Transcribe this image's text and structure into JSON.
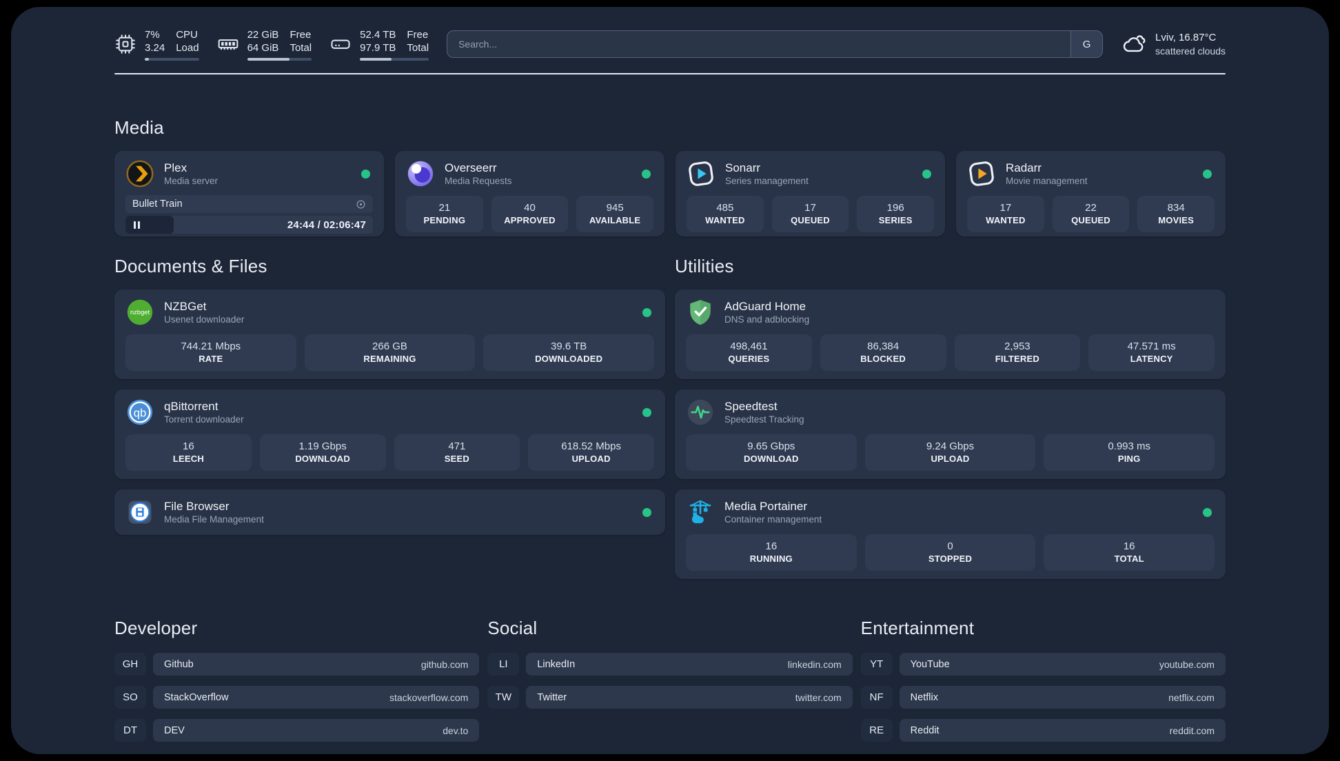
{
  "header": {
    "resources": [
      {
        "values": [
          "7%",
          "3.24"
        ],
        "labels": [
          "CPU",
          "Load"
        ],
        "progress": "7%"
      },
      {
        "values": [
          "22 GiB",
          "64 GiB"
        ],
        "labels": [
          "Free",
          "Total"
        ],
        "progress": "66%"
      },
      {
        "values": [
          "52.4 TB",
          "97.9 TB"
        ],
        "labels": [
          "Free",
          "Total"
        ],
        "progress": "46%"
      }
    ],
    "search": {
      "placeholder": "Search...",
      "provider": "G"
    },
    "weather": {
      "location": "Lviv, 16.87°C",
      "condition": "scattered clouds"
    }
  },
  "media": {
    "title": "Media",
    "plex": {
      "name": "Plex",
      "desc": "Media server",
      "now_playing": {
        "title": "Bullet Train",
        "time_display": "24:44 / 02:06:47",
        "progress": "19.5%"
      }
    },
    "overseerr": {
      "name": "Overseerr",
      "desc": "Media Requests",
      "stats": [
        {
          "value": "21",
          "label": "PENDING"
        },
        {
          "value": "40",
          "label": "APPROVED"
        },
        {
          "value": "945",
          "label": "AVAILABLE"
        }
      ]
    },
    "sonarr": {
      "name": "Sonarr",
      "desc": "Series management",
      "stats": [
        {
          "value": "485",
          "label": "WANTED"
        },
        {
          "value": "17",
          "label": "QUEUED"
        },
        {
          "value": "196",
          "label": "SERIES"
        }
      ]
    },
    "radarr": {
      "name": "Radarr",
      "desc": "Movie management",
      "stats": [
        {
          "value": "17",
          "label": "WANTED"
        },
        {
          "value": "22",
          "label": "QUEUED"
        },
        {
          "value": "834",
          "label": "MOVIES"
        }
      ]
    }
  },
  "documents": {
    "title": "Documents & Files",
    "nzbget": {
      "name": "NZBGet",
      "desc": "Usenet downloader",
      "stats": [
        {
          "value": "744.21 Mbps",
          "label": "RATE"
        },
        {
          "value": "266 GB",
          "label": "REMAINING"
        },
        {
          "value": "39.6 TB",
          "label": "DOWNLOADED"
        }
      ]
    },
    "qbittorrent": {
      "name": "qBittorrent",
      "desc": "Torrent downloader",
      "stats": [
        {
          "value": "16",
          "label": "LEECH"
        },
        {
          "value": "1.19 Gbps",
          "label": "DOWNLOAD"
        },
        {
          "value": "471",
          "label": "SEED"
        },
        {
          "value": "618.52 Mbps",
          "label": "UPLOAD"
        }
      ]
    },
    "filebrowser": {
      "name": "File Browser",
      "desc": "Media File Management"
    }
  },
  "utilities": {
    "title": "Utilities",
    "adguard": {
      "name": "AdGuard Home",
      "desc": "DNS and adblocking",
      "stats": [
        {
          "value": "498,461",
          "label": "QUERIES"
        },
        {
          "value": "86,384",
          "label": "BLOCKED"
        },
        {
          "value": "2,953",
          "label": "FILTERED"
        },
        {
          "value": "47.571 ms",
          "label": "LATENCY"
        }
      ]
    },
    "speedtest": {
      "name": "Speedtest",
      "desc": "Speedtest Tracking",
      "stats": [
        {
          "value": "9.65 Gbps",
          "label": "DOWNLOAD"
        },
        {
          "value": "9.24 Gbps",
          "label": "UPLOAD"
        },
        {
          "value": "0.993 ms",
          "label": "PING"
        }
      ]
    },
    "portainer": {
      "name": "Media Portainer",
      "desc": "Container management",
      "stats": [
        {
          "value": "16",
          "label": "RUNNING"
        },
        {
          "value": "0",
          "label": "STOPPED"
        },
        {
          "value": "16",
          "label": "TOTAL"
        }
      ]
    }
  },
  "bookmarks": [
    {
      "title": "Developer",
      "links": [
        {
          "abbr": "GH",
          "name": "Github",
          "url": "github.com"
        },
        {
          "abbr": "SO",
          "name": "StackOverflow",
          "url": "stackoverflow.com"
        },
        {
          "abbr": "DT",
          "name": "DEV",
          "url": "dev.to"
        }
      ]
    },
    {
      "title": "Social",
      "links": [
        {
          "abbr": "LI",
          "name": "LinkedIn",
          "url": "linkedin.com"
        },
        {
          "abbr": "TW",
          "name": "Twitter",
          "url": "twitter.com"
        }
      ]
    },
    {
      "title": "Entertainment",
      "links": [
        {
          "abbr": "YT",
          "name": "YouTube",
          "url": "youtube.com"
        },
        {
          "abbr": "NF",
          "name": "Netflix",
          "url": "netflix.com"
        },
        {
          "abbr": "RE",
          "name": "Reddit",
          "url": "reddit.com"
        }
      ]
    }
  ],
  "colors": {
    "status_online": "#27c489",
    "plex_accent": "#e8a00d",
    "sonarr_accent": "#38c6f4",
    "radarr_accent": "#f5a623",
    "portainer_accent": "#1fb1e6",
    "adguard_accent": "#63b877",
    "nzbget_accent": "#4fae32",
    "qbittorrent_accent": "#4a8fd6"
  }
}
